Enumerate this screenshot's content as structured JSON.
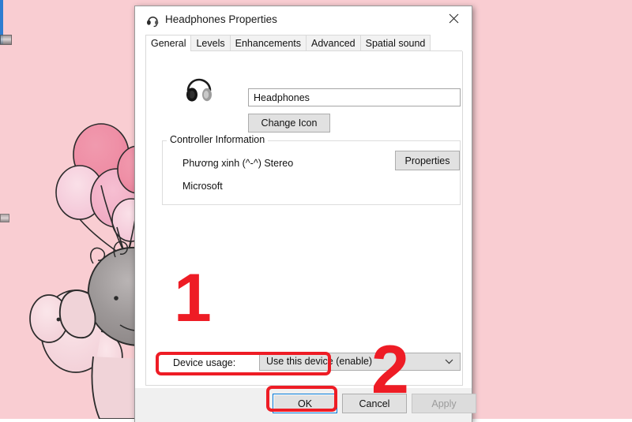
{
  "desktop": {
    "wallpaper_description": "pink watercolor balloons and elephants",
    "background_color": "#f9cdd2"
  },
  "dialog": {
    "title": "Headphones Properties",
    "title_icon": "headset-icon",
    "close_icon": "close-icon",
    "tabs": [
      {
        "label": "General",
        "selected": true
      },
      {
        "label": "Levels",
        "selected": false
      },
      {
        "label": "Enhancements",
        "selected": false
      },
      {
        "label": "Advanced",
        "selected": false
      },
      {
        "label": "Spatial sound",
        "selected": false
      }
    ],
    "general": {
      "device_icon": "headphones-icon",
      "device_name_value": "Headphones",
      "device_name_placeholder": "Headphones",
      "change_icon_label": "Change Icon",
      "controller_information": {
        "legend": "Controller Information",
        "line1": "Phương xinh (^-^) Stereo",
        "line2": "Microsoft",
        "properties_label": "Properties"
      },
      "device_usage": {
        "label": "Device usage:",
        "selected_value": "Use this device (enable)",
        "dropdown_icon": "chevron-down-icon"
      }
    },
    "footer": {
      "ok_label": "OK",
      "cancel_label": "Cancel",
      "apply_label": "Apply",
      "apply_disabled": true
    }
  },
  "annotations": {
    "color": "#ee1c25",
    "step1_number": "1",
    "step2_number": "2",
    "step1_target": "Device usage dropdown",
    "step2_target": "OK button"
  }
}
